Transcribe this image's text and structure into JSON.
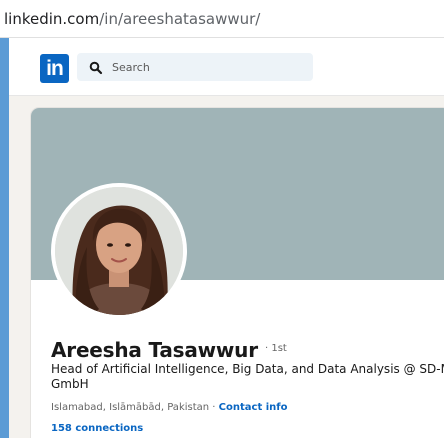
{
  "browser": {
    "url_domain": "linkedin.com",
    "url_path": "/in/areeshatasawwur/"
  },
  "nav": {
    "logo_text": "in",
    "search": {
      "placeholder": "Search"
    }
  },
  "profile": {
    "name": "Areesha Tasawwur",
    "degree": "· 1st",
    "headline": "Head of Artificial Intelligence, Big Data, and Data Analysis @ SD-M GmbH",
    "location": "Islamabad, Islāmābād, Pakistan · ",
    "contact_info": "Contact info",
    "connections": "158 connections"
  },
  "colors": {
    "brand": "#0a66c2",
    "cover": "#a0b4b7",
    "search_bg": "#edf3f8"
  }
}
